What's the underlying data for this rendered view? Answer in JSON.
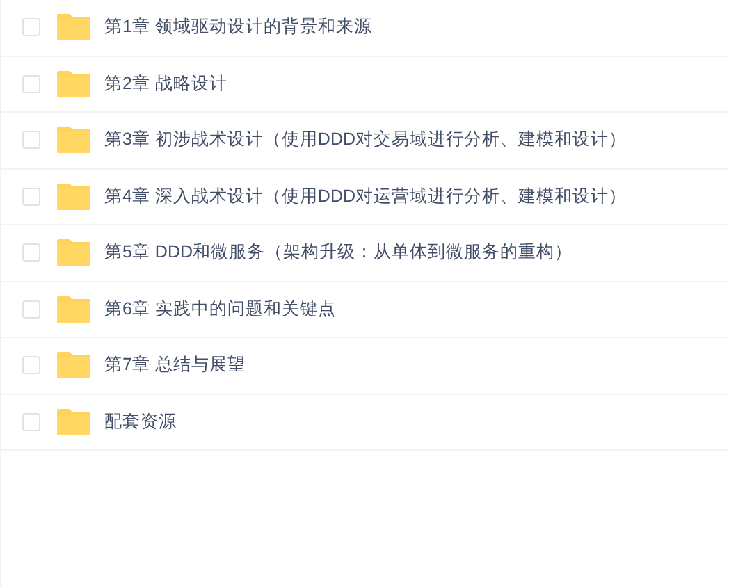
{
  "files": [
    {
      "name": "第1章 领域驱动设计的背景和来源",
      "checked": false
    },
    {
      "name": "第2章 战略设计",
      "checked": false
    },
    {
      "name": "第3章 初涉战术设计（使用DDD对交易域进行分析、建模和设计）",
      "checked": false
    },
    {
      "name": "第4章 深入战术设计（使用DDD对运营域进行分析、建模和设计）",
      "checked": false
    },
    {
      "name": "第5章 DDD和微服务（架构升级：从单体到微服务的重构）",
      "checked": false
    },
    {
      "name": "第6章 实践中的问题和关键点",
      "checked": false
    },
    {
      "name": "第7章 总结与展望",
      "checked": false
    },
    {
      "name": "配套资源",
      "checked": false
    }
  ]
}
